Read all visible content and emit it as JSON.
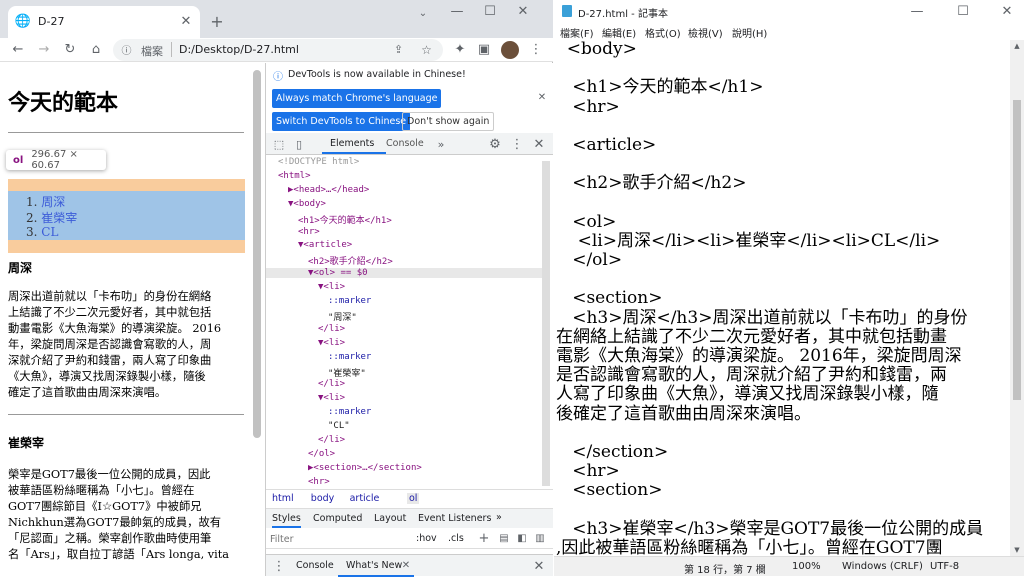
{
  "browser": {
    "tab_title": "D-27",
    "address_label": "檔案",
    "address_url": "D:/Desktop/D-27.html"
  },
  "page": {
    "h1": "今天的範本",
    "ol_items": [
      "周深",
      "崔榮宰",
      "CL"
    ],
    "tooltip_tag": "ol",
    "tooltip_size": "296.67 × 60.67",
    "h3_1": "周深",
    "p1_lines": [
      "周深出道前就以「卡布叻」的身份在網絡",
      "上結識了不少二次元愛好者，其中就包括",
      "動畫電影《大魚海棠》的導演梁旋。 2016",
      "年，梁旋問周深是否認識會寫歌的人，周",
      "深就介紹了尹約和錢雷，兩人寫了印象曲",
      "《大魚》，導演又找周深錄製小樣，隨後",
      "確定了這首歌曲由周深來演唱。"
    ],
    "h3_2": "崔榮宰",
    "p2_lines": [
      "榮宰是GOT7最後一位公開的成員，因此",
      "被華語區粉絲暱稱為「小七」。曾經在",
      "GOT7團綜節目《I☆GOT7》中被師兄",
      "Nichkhun選為GOT7最帥氣的成員，故有",
      "「尼認面」之稱。榮宰創作歌曲時使用筆",
      "名「Ars」，取自拉丁諺語「Ars longa, vita"
    ]
  },
  "devtools": {
    "banner": "DevTools is now available in Chinese!",
    "btn_match": "Always match Chrome's language",
    "btn_switch": "Switch DevTools to Chinese",
    "btn_dont": "Don't show again",
    "tab_elements": "Elements",
    "tab_console": "Console",
    "dom_lines": [
      {
        "indent": 0,
        "text": "<!DOCTYPE html>",
        "cls": "doctype"
      },
      {
        "indent": 0,
        "text": "<html>"
      },
      {
        "indent": 1,
        "text": "▶<head>…</head>"
      },
      {
        "indent": 1,
        "text": "▼<body>"
      },
      {
        "indent": 2,
        "text": "<h1>今天的範本</h1>"
      },
      {
        "indent": 2,
        "text": "<hr>"
      },
      {
        "indent": 2,
        "text": "▼<article>"
      },
      {
        "indent": 3,
        "text": "<h2>歌手介紹</h2>"
      },
      {
        "indent": 3,
        "text": "▼<ol> == $0",
        "sel": true
      },
      {
        "indent": 4,
        "text": "▼<li>"
      },
      {
        "indent": 5,
        "text": "::marker"
      },
      {
        "indent": 5,
        "text": "\"周深\""
      },
      {
        "indent": 4,
        "text": "</li>"
      },
      {
        "indent": 4,
        "text": "▼<li>"
      },
      {
        "indent": 5,
        "text": "::marker"
      },
      {
        "indent": 5,
        "text": "\"崔榮宰\""
      },
      {
        "indent": 4,
        "text": "</li>"
      },
      {
        "indent": 4,
        "text": "▼<li>"
      },
      {
        "indent": 5,
        "text": "::marker"
      },
      {
        "indent": 5,
        "text": "\"CL\""
      },
      {
        "indent": 4,
        "text": "</li>"
      },
      {
        "indent": 3,
        "text": "</ol>"
      },
      {
        "indent": 3,
        "text": "▶<section>…</section>"
      },
      {
        "indent": 3,
        "text": "<hr>"
      }
    ],
    "crumbs": [
      "html",
      "body",
      "article",
      "ol"
    ],
    "styles_tabs": [
      "Styles",
      "Computed",
      "Layout",
      "Event Listeners"
    ],
    "filter_placeholder": "Filter",
    "hov": ":hov",
    "cls": ".cls",
    "drawer_console": "Console",
    "drawer_whatsnew": "What's New"
  },
  "notepad": {
    "title": "D-27.html - 記事本",
    "menu": [
      "檔案(F)",
      "編輯(E)",
      "格式(O)",
      "檢視(V)",
      "說明(H)"
    ],
    "lines": [
      "  <body>",
      "",
      "   <h1>今天的範本</h1>",
      "   <hr>",
      "",
      "   <article>",
      "",
      "   <h2>歌手介紹</h2>",
      "",
      "   <ol>",
      "    <li>周深</li><li>崔榮宰</li><li>CL</li>",
      "   </ol>",
      "",
      "   <section>",
      "   <h3>周深</h3>周深出道前就以「卡布叻」的身份",
      "在網絡上結識了不少二次元愛好者，其中就包括動畫",
      "電影《大魚海棠》的導演梁旋。 2016年，梁旋問周深",
      "是否認識會寫歌的人，周深就介紹了尹約和錢雷，兩",
      "人寫了印象曲《大魚》，導演又找周深錄製小樣，隨",
      "後確定了這首歌曲由周深來演唱。",
      "",
      "   </section>",
      "   <hr>",
      "   <section>",
      "",
      "   <h3>崔榮宰</h3>榮宰是GOT7最後一位公開的成員",
      ",因此被華語區粉絲暱稱為「小七」。曾經在GOT7團"
    ],
    "status_pos": "第 18 行，第 7 欄",
    "status_zoom": "100%",
    "status_eol": "Windows (CRLF)",
    "status_enc": "UTF-8"
  }
}
